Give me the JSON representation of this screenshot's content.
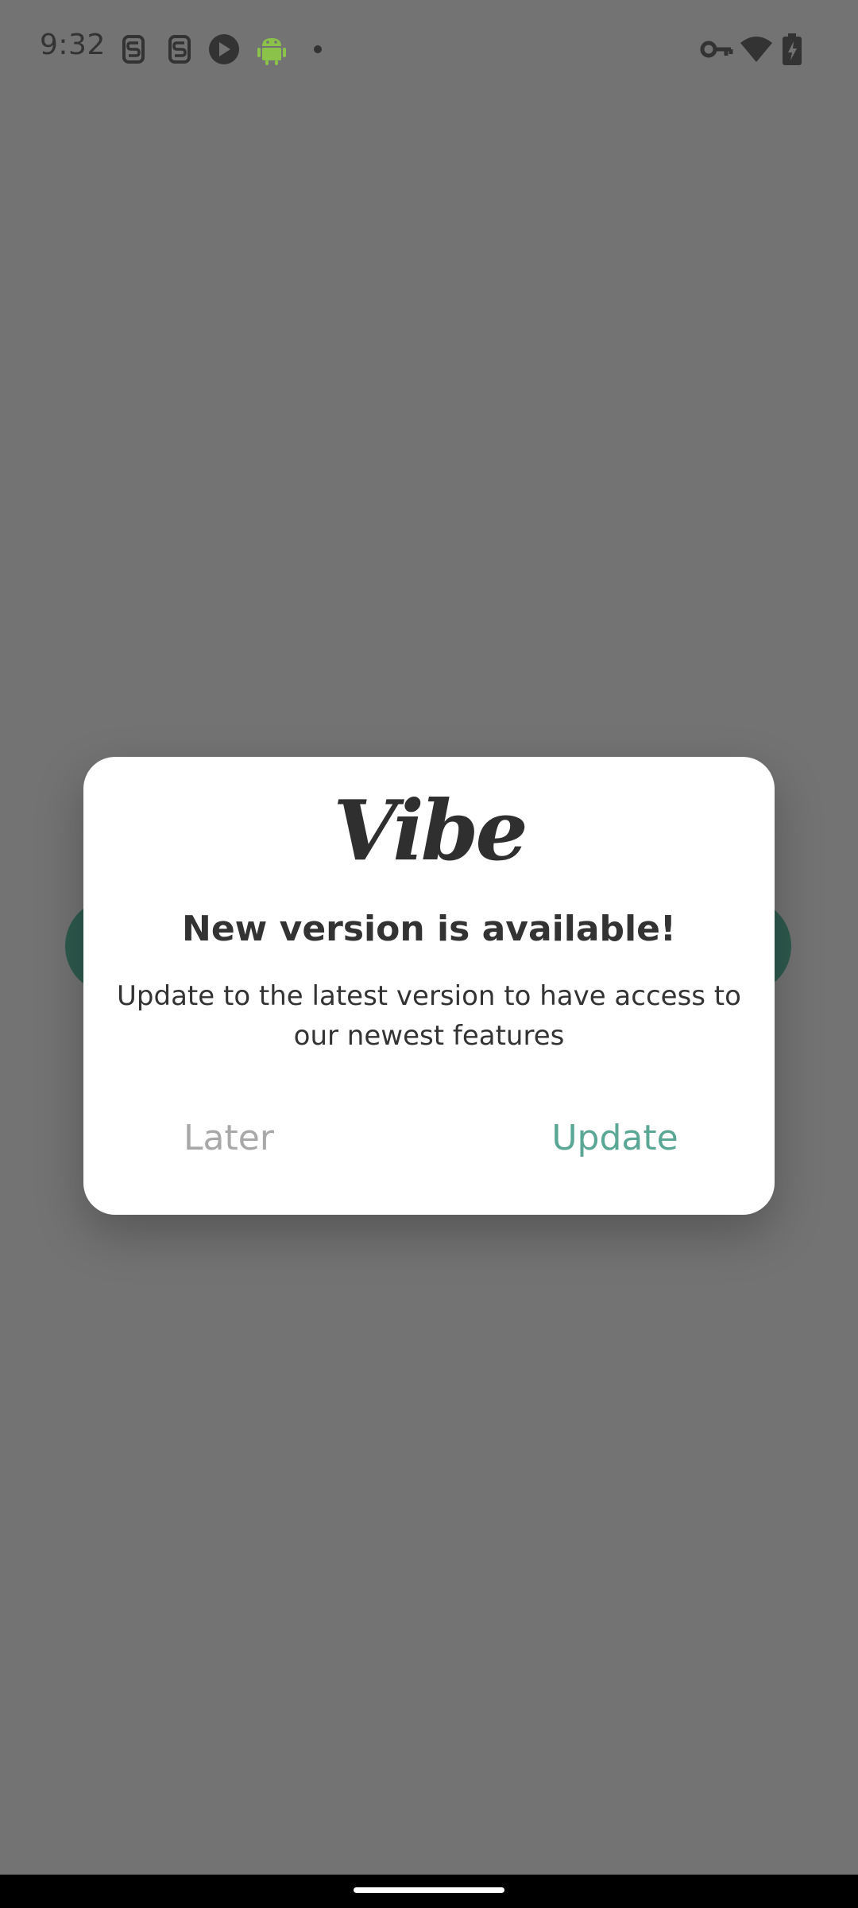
{
  "status_bar": {
    "time": "9:32",
    "left_icons": [
      "sim-s-icon",
      "sim-s-icon",
      "camera-aperture-icon",
      "android-icon",
      "dot-icon"
    ],
    "right_icons": [
      "vpn-key-icon",
      "wifi-icon",
      "battery-charging-icon"
    ]
  },
  "dialog": {
    "logo_text": "Vibe",
    "title": "New version is available!",
    "message": "Update to the latest version to have access to our newest features",
    "later_label": "Later",
    "update_label": "Update"
  },
  "colors": {
    "scrim": "#737373",
    "accent": "#5aa795",
    "later_text": "#a8a8a8",
    "background_pill": "#2e5a4e"
  }
}
